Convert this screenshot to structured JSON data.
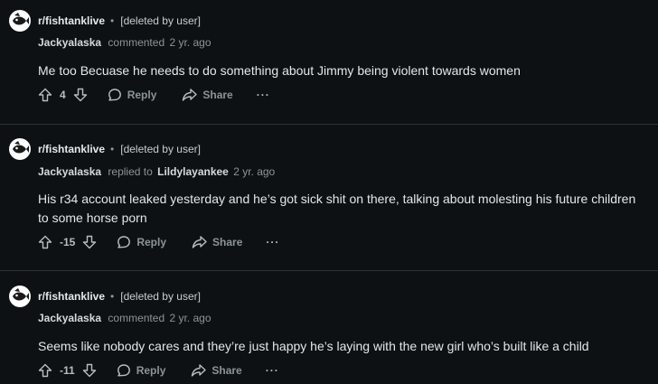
{
  "comments": [
    {
      "subreddit": "r/fishtanklive",
      "separator": "•",
      "post_author": "[deleted by user]",
      "author": "Jackyalaska",
      "action": "commented",
      "reply_to": "",
      "age": "2 yr. ago",
      "text": "Me too Becuase he needs to do something about Jimmy being violent towards women",
      "score": "4",
      "reply_label": "Reply",
      "share_label": "Share",
      "more_label": "···"
    },
    {
      "subreddit": "r/fishtanklive",
      "separator": "•",
      "post_author": "[deleted by user]",
      "author": "Jackyalaska",
      "action": "replied to",
      "reply_to": "Lildylayankee",
      "age": "2 yr. ago",
      "text": "His r34 account leaked yesterday and he’s got sick shit on there, talking about molesting his future children to some horse porn",
      "score": "-15",
      "reply_label": "Reply",
      "share_label": "Share",
      "more_label": "···"
    },
    {
      "subreddit": "r/fishtanklive",
      "separator": "•",
      "post_author": "[deleted by user]",
      "author": "Jackyalaska",
      "action": "commented",
      "reply_to": "",
      "age": "2 yr. ago",
      "text": "Seems like nobody cares and they’re just happy he’s laying with the new girl who’s built like a child",
      "score": "-11",
      "reply_label": "Reply",
      "share_label": "Share",
      "more_label": "···"
    }
  ],
  "icons": {
    "avatar": "fish-avatar-icon",
    "upvote": "arrow-up-icon",
    "downvote": "arrow-down-icon",
    "reply": "speech-bubble-icon",
    "share": "share-arrow-icon"
  },
  "colors": {
    "background": "#0e1113",
    "text": "#e4e7e9",
    "muted": "#8b9498",
    "divider": "#2a3236"
  }
}
